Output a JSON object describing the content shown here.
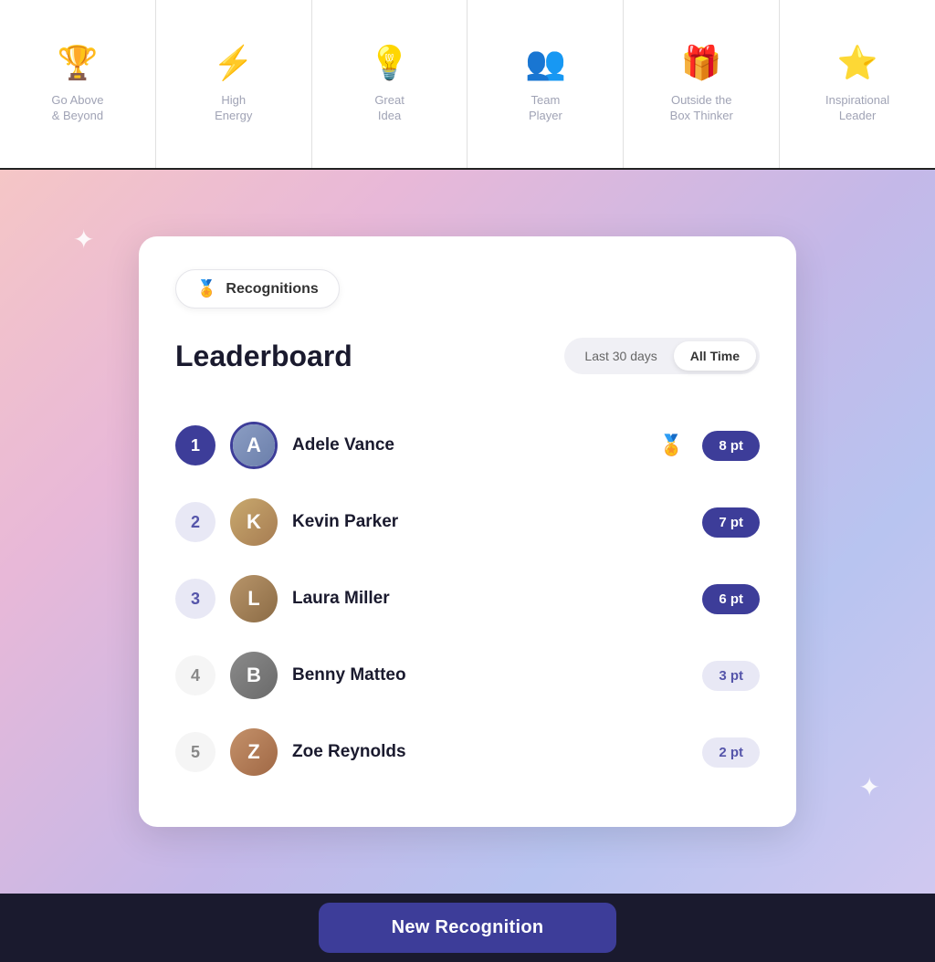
{
  "topStrip": {
    "cards": [
      {
        "id": "go-above-beyond",
        "icon": "🏆",
        "label": "Go Above\n& Beyond"
      },
      {
        "id": "high-energy",
        "icon": "⚡",
        "label": "High\nEnergy"
      },
      {
        "id": "great-idea",
        "icon": "💡",
        "label": "Great\nIdea"
      },
      {
        "id": "team-player",
        "icon": "👥",
        "label": "Team\nPlayer"
      },
      {
        "id": "outside-box",
        "icon": "🎁",
        "label": "Outside the\nBox Thinker"
      },
      {
        "id": "inspirational-leader",
        "icon": "⭐",
        "label": "Inspirational\nLeader"
      }
    ]
  },
  "tab": {
    "icon": "🏅",
    "label": "Recognitions"
  },
  "leaderboard": {
    "title": "Leaderboard",
    "filters": [
      {
        "id": "last30",
        "label": "Last 30 days",
        "active": false
      },
      {
        "id": "alltime",
        "label": "All Time",
        "active": true
      }
    ],
    "entries": [
      {
        "rank": 1,
        "name": "Adele Vance",
        "points": "8 pt",
        "hasTrophy": true,
        "rankClass": "rank-1",
        "ptsClass": "pts-high",
        "avatarClass": "av1",
        "avatarInitial": "A"
      },
      {
        "rank": 2,
        "name": "Kevin Parker",
        "points": "7 pt",
        "hasTrophy": false,
        "rankClass": "rank-2",
        "ptsClass": "pts-high",
        "avatarClass": "av2",
        "avatarInitial": "K"
      },
      {
        "rank": 3,
        "name": "Laura Miller",
        "points": "6 pt",
        "hasTrophy": false,
        "rankClass": "rank-3",
        "ptsClass": "pts-high",
        "avatarClass": "av3",
        "avatarInitial": "L"
      },
      {
        "rank": 4,
        "name": "Benny Matteo",
        "points": "3 pt",
        "hasTrophy": false,
        "rankClass": "rank-4",
        "ptsClass": "pts-low",
        "avatarClass": "av4",
        "avatarInitial": "B"
      },
      {
        "rank": 5,
        "name": "Zoe Reynolds",
        "points": "2 pt",
        "hasTrophy": false,
        "rankClass": "rank-5",
        "ptsClass": "pts-low",
        "avatarClass": "av5",
        "avatarInitial": "Z"
      }
    ]
  },
  "bottomBar": {
    "buttonLabel": "New Recognition"
  }
}
